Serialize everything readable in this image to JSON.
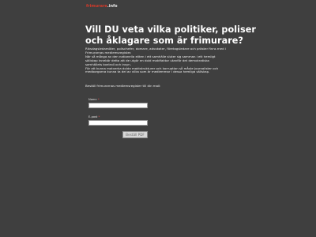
{
  "logo": {
    "main": "frimurare",
    "tld": ".info"
  },
  "headline": {
    "line1": "Vill DU veta vilka politiker, poliser",
    "line2": "och åklagare som är frimurare?"
  },
  "intro": {
    "line1": "Riksdagsledamöter, polischefer, domare, advokater, företagsledare och präster finns med i",
    "line2": "Frimurarnas medlemsregister.",
    "line3": "När så många av den nationella eliten i ett samhälle sluter sig samman i ett hemligt",
    "line4": "sällskap innebär detta att de utgör en dold maktfaktor utanför det demokratiska",
    "line5": "samhällets kontroll och insyn.",
    "line6": "För att kunna motverka dolda maktstrukturer och korruption så måste journalister och",
    "line7": "medborgarna kunna ta del av vilka som är medlemmar i dessa hemliga sällskap."
  },
  "order_text": "Beställ frimurarnas medlemsregister till din mail:",
  "form": {
    "name_label": "Namn",
    "email_label": "E-post",
    "required_marker": "*",
    "name_value": "",
    "email_value": "",
    "submit_label": "Beställ PDF"
  },
  "colors": {
    "background": "#3f3f3f",
    "logo_accent": "#d23a2a",
    "required_marker": "#e05050"
  }
}
